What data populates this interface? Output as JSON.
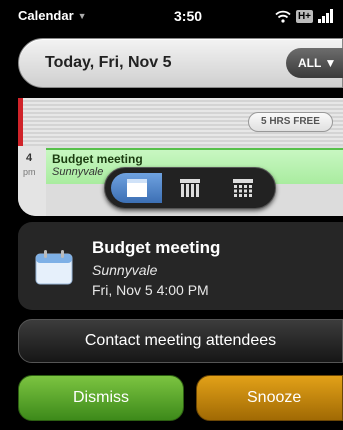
{
  "status_bar": {
    "app_name": "Calendar",
    "time": "3:50",
    "network": "H+",
    "icons": [
      "chevron-down-icon",
      "wifi-icon",
      "signal-bars-icon"
    ]
  },
  "header": {
    "title": "Today, Fri, Nov 5",
    "filter_label": "ALL",
    "filter_icon": "chevron-down-icon"
  },
  "calendar": {
    "free_time_badge": "5 HRS FREE",
    "hour": "4",
    "ampm": "pm",
    "event": {
      "title": "Budget meeting",
      "location": "Sunnyvale"
    },
    "event_color": "#a9ec9f",
    "now_marker_color": "#d0242a"
  },
  "view_switcher": {
    "active_view": "day",
    "options": [
      "day-view-icon",
      "week-view-icon",
      "month-view-icon"
    ],
    "accent": "#3c6fb4"
  },
  "notification": {
    "icon": "calendar-icon",
    "title": "Budget meeting",
    "location": "Sunnyvale",
    "time": "Fri, Nov 5 4:00 PM"
  },
  "actions": {
    "contact_label": "Contact meeting attendees",
    "dismiss_label": "Dismiss",
    "snooze_label": "Snooze",
    "dismiss_color": "#5aa82c",
    "snooze_color": "#c8870c"
  }
}
